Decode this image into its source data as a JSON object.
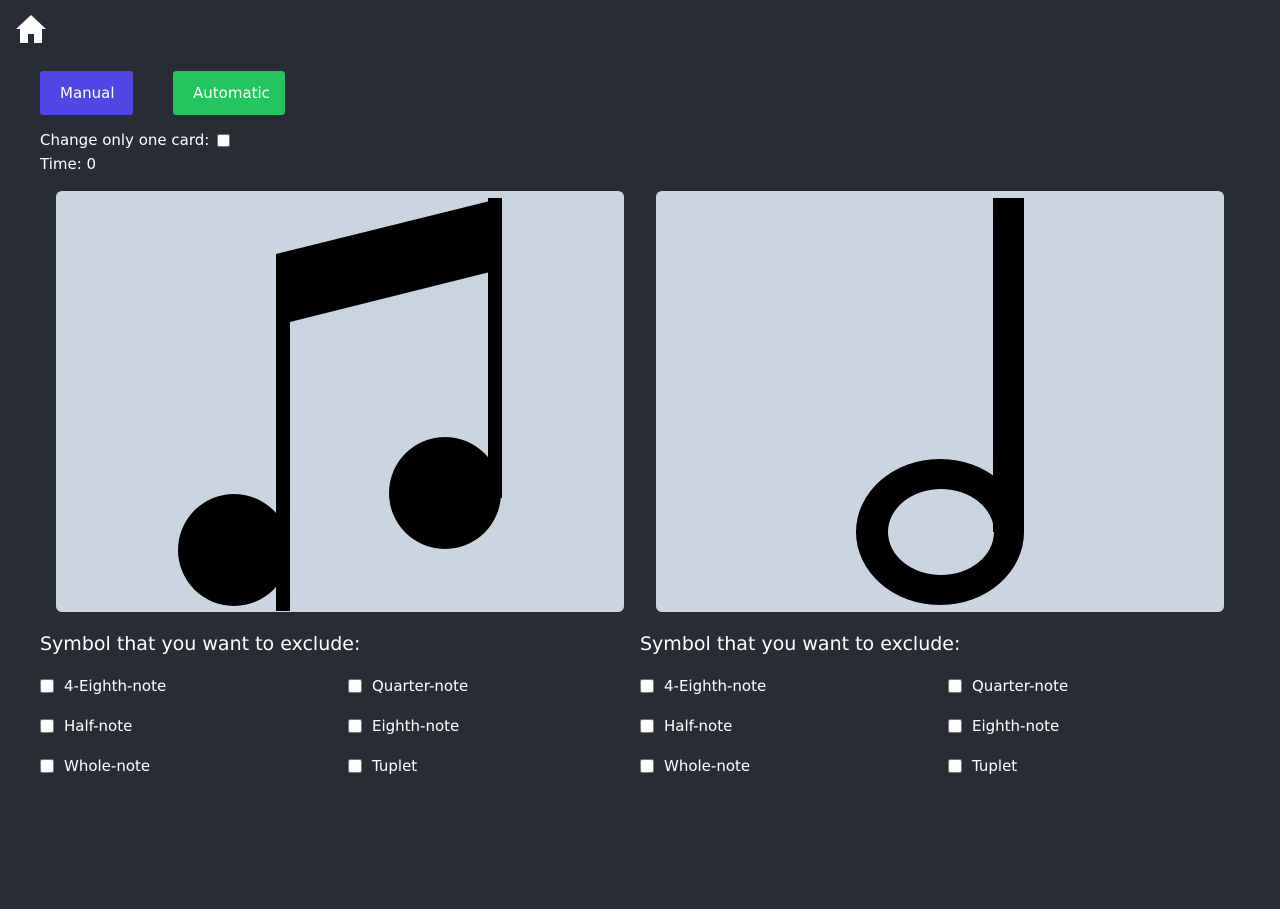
{
  "nav": {
    "home_icon": "home-icon"
  },
  "mode_buttons": {
    "manual_label": "Manual",
    "automatic_label": "Automatic",
    "manual_color": "#4f46e5",
    "automatic_color": "#22c55e"
  },
  "options": {
    "change_one_card_label": "Change only one card:",
    "change_one_card_checked": false,
    "time_label": "Time: 0"
  },
  "cards": [
    {
      "symbol": "beamed-eighth-notes"
    },
    {
      "symbol": "half-note"
    }
  ],
  "exclude_panels": [
    {
      "title": "Symbol that you want to exclude:",
      "items": [
        {
          "label": "4-Eighth-note",
          "checked": false
        },
        {
          "label": "Quarter-note",
          "checked": false
        },
        {
          "label": "Half-note",
          "checked": false
        },
        {
          "label": "Eighth-note",
          "checked": false
        },
        {
          "label": "Whole-note",
          "checked": false
        },
        {
          "label": "Tuplet",
          "checked": false
        }
      ]
    },
    {
      "title": "Symbol that you want to exclude:",
      "items": [
        {
          "label": "4-Eighth-note",
          "checked": false
        },
        {
          "label": "Quarter-note",
          "checked": false
        },
        {
          "label": "Half-note",
          "checked": false
        },
        {
          "label": "Eighth-note",
          "checked": false
        },
        {
          "label": "Whole-note",
          "checked": false
        },
        {
          "label": "Tuplet",
          "checked": false
        }
      ]
    }
  ],
  "colors": {
    "background": "#282c35",
    "card": "#cbd5e1",
    "text": "#ffffff"
  }
}
